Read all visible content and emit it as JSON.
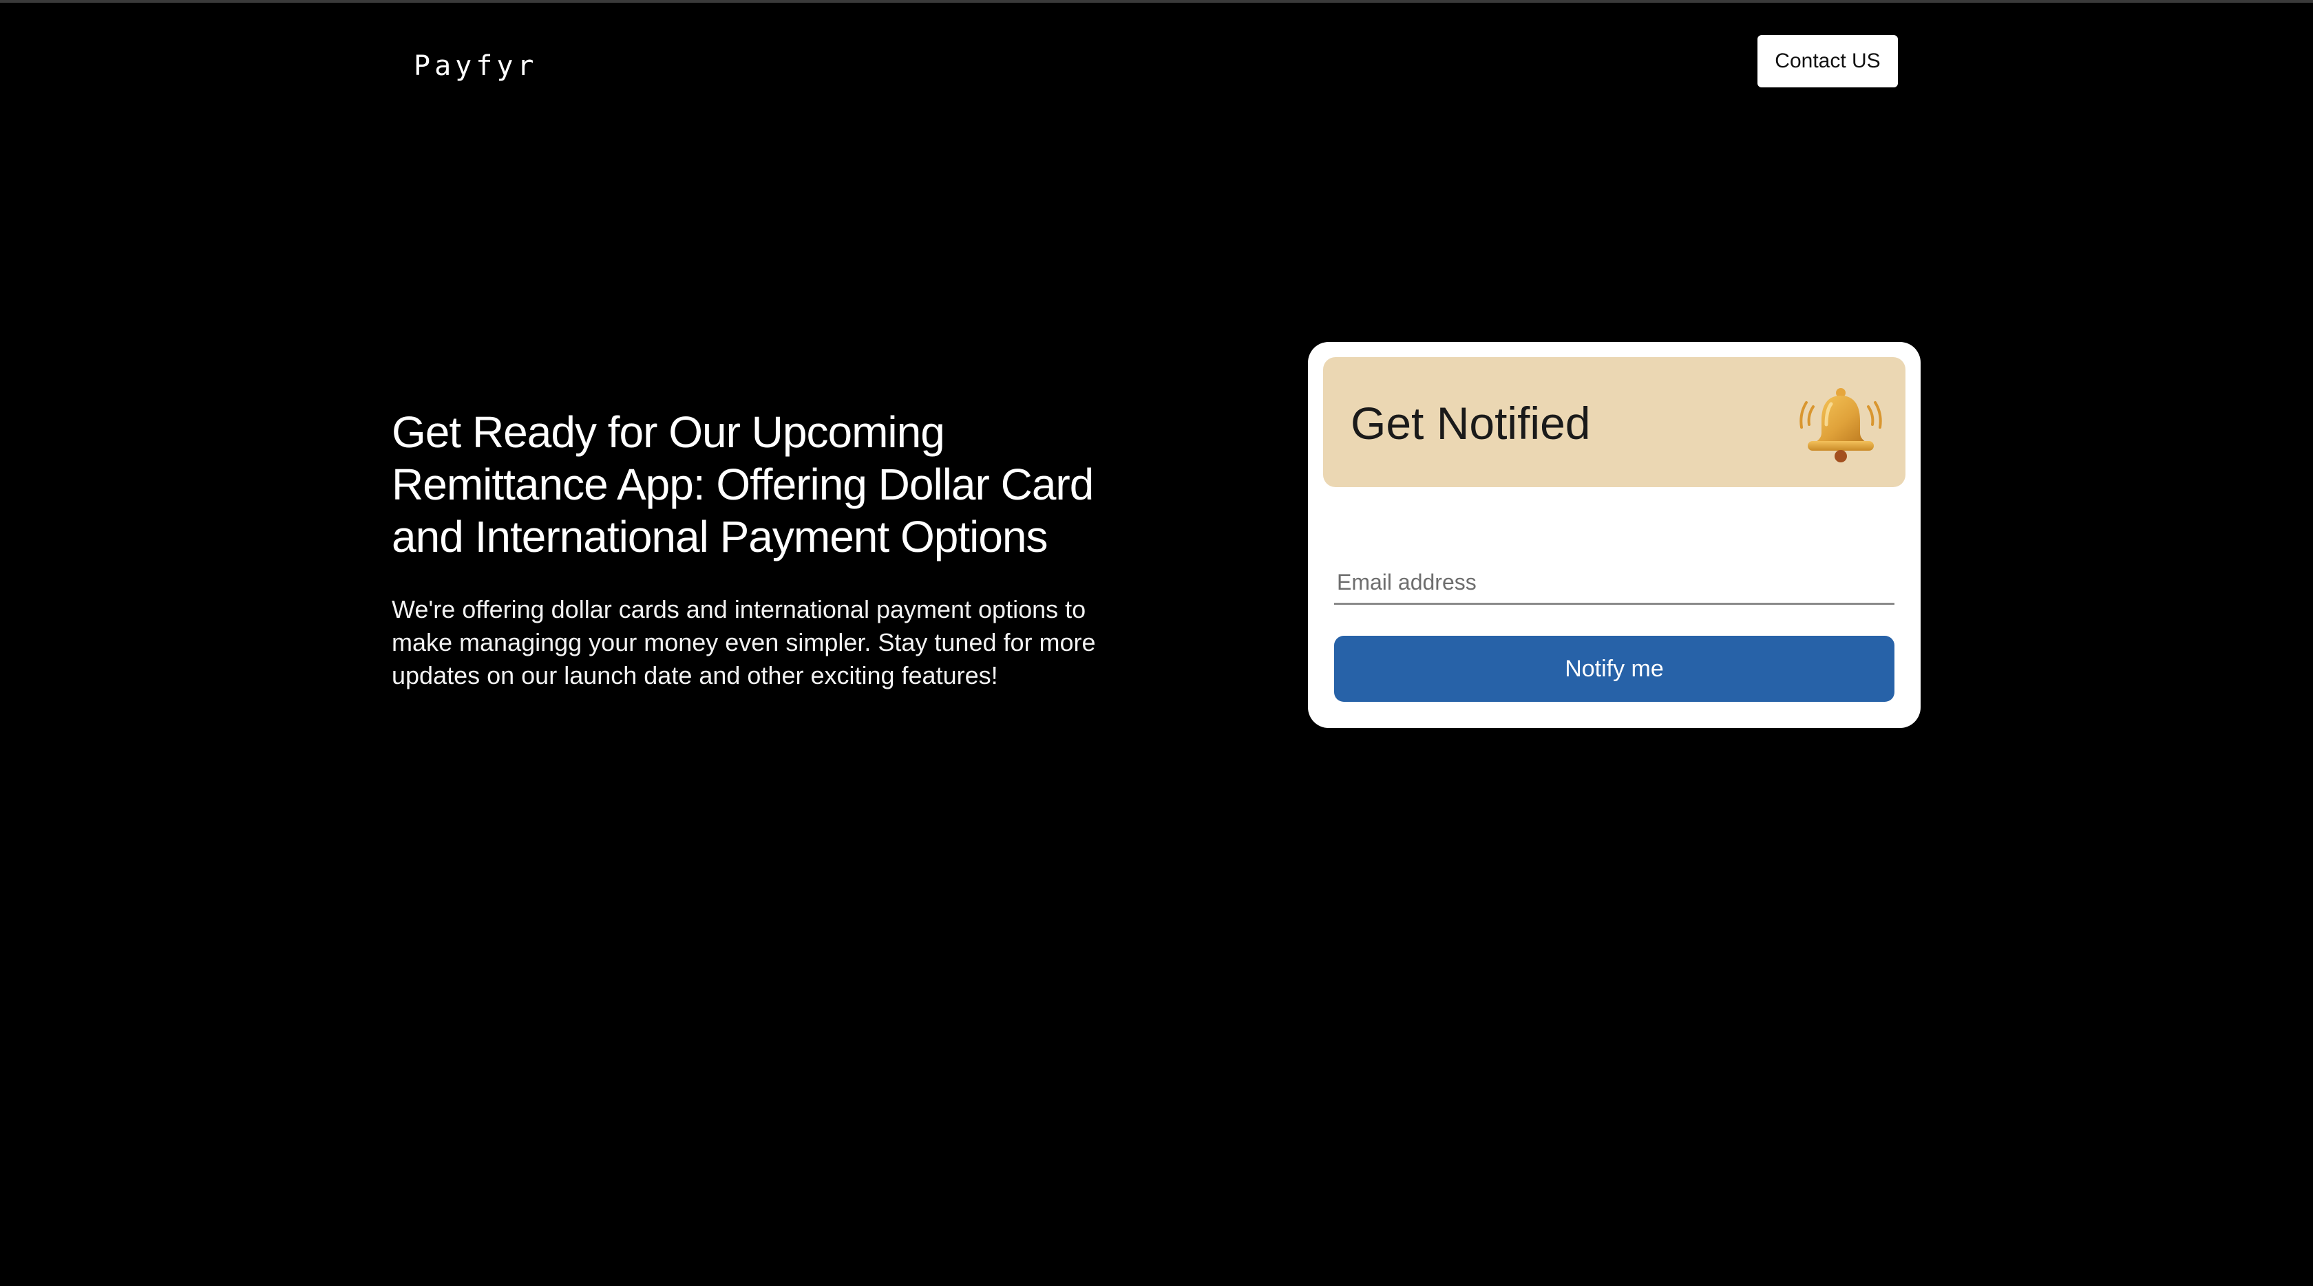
{
  "header": {
    "logo_text": "Payfyr",
    "contact_label": "Contact US"
  },
  "hero": {
    "title": "Get Ready for Our Upcoming Remittance App: Offering Dollar Card and International Payment Options",
    "description": "We're offering dollar cards and international payment options to make managingg your money even simpler. Stay tuned for more updates on our launch date and other exciting features!"
  },
  "notify_card": {
    "title": "Get Notified",
    "icon": "bell-icon",
    "email_placeholder": "Email address",
    "email_value": "",
    "button_label": "Notify me"
  },
  "colors": {
    "background": "#000000",
    "card_background": "#ffffff",
    "card_header": "#ebd7b3",
    "button_primary": "#2762a8",
    "bell": "#e0a23a"
  }
}
